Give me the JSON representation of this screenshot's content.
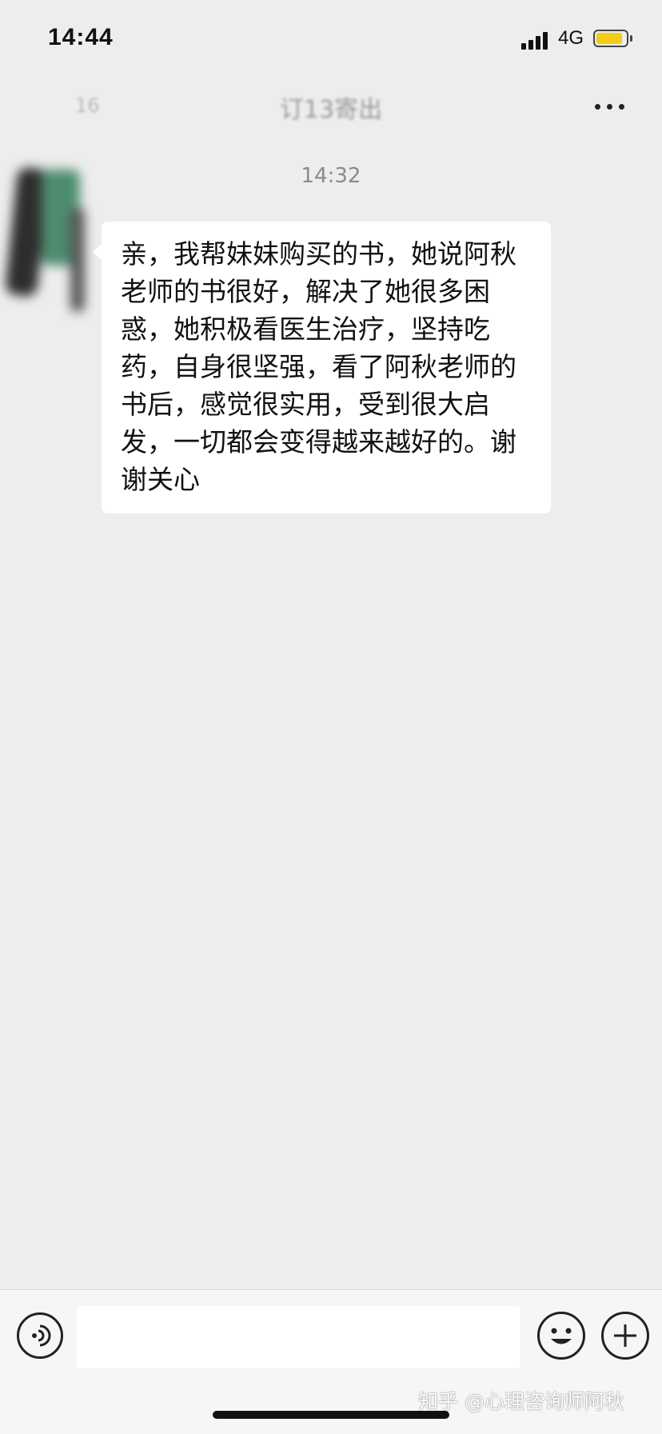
{
  "status_bar": {
    "time": "14:44",
    "network": "4G",
    "battery_level": 0.9,
    "battery_color": "#f2cc15"
  },
  "nav": {
    "back_count": "16",
    "title": "订13寄出",
    "more_icon": "more-dots-icon"
  },
  "messages": [
    {
      "time": "14:32",
      "sender": "incoming",
      "text": "亲，我帮妹妹购买的书，她说阿秋老师的书很好，解决了她很多困惑，她积极看医生治疗，坚持吃药，自身很坚强，看了阿秋老师的书后，感觉很实用，受到很大启发，一切都会变得越来越好的。谢谢关心"
    }
  ],
  "input_bar": {
    "voice_icon": "voice-icon",
    "input_value": "",
    "emoji_icon": "emoji-icon",
    "plus_icon": "plus-icon"
  },
  "watermark": "知乎 @心理咨询师阿秋"
}
